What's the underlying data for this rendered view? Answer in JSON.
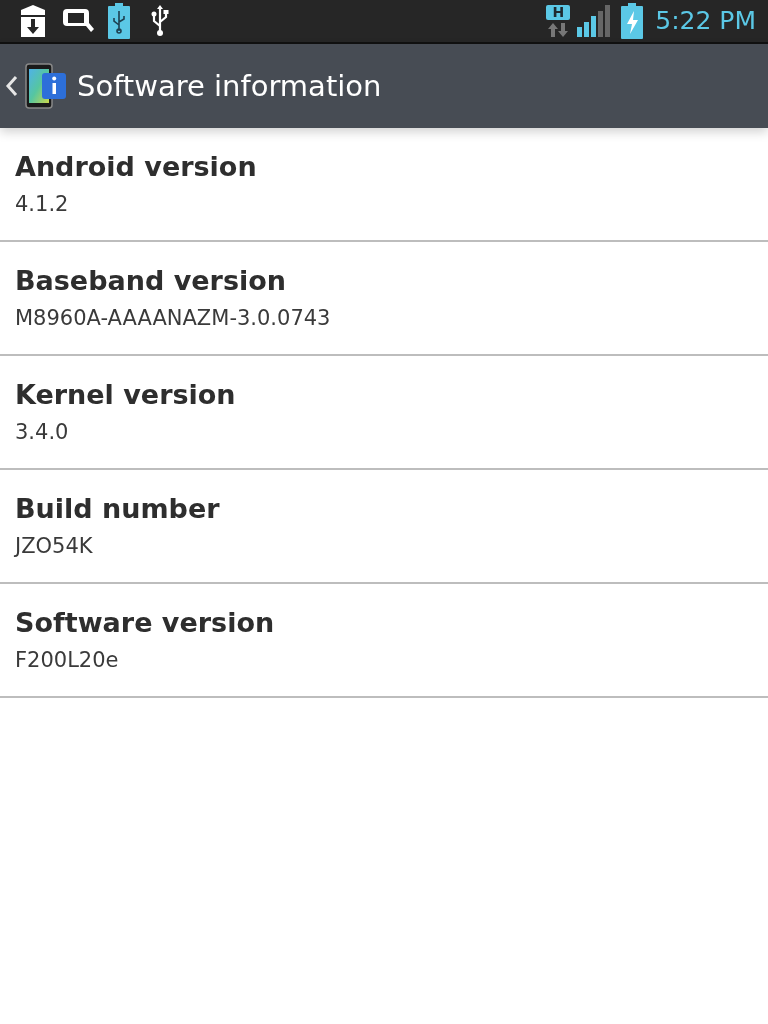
{
  "status_bar": {
    "network_type": "H",
    "time": "5:22 PM"
  },
  "header": {
    "title": "Software information"
  },
  "items": [
    {
      "title": "Android version",
      "value": "4.1.2"
    },
    {
      "title": "Baseband version",
      "value": "M8960A-AAAANAZM-3.0.0743"
    },
    {
      "title": "Kernel version",
      "value": "3.4.0"
    },
    {
      "title": "Build number",
      "value": "JZO54K"
    },
    {
      "title": "Software version",
      "value": "F200L20e"
    }
  ]
}
